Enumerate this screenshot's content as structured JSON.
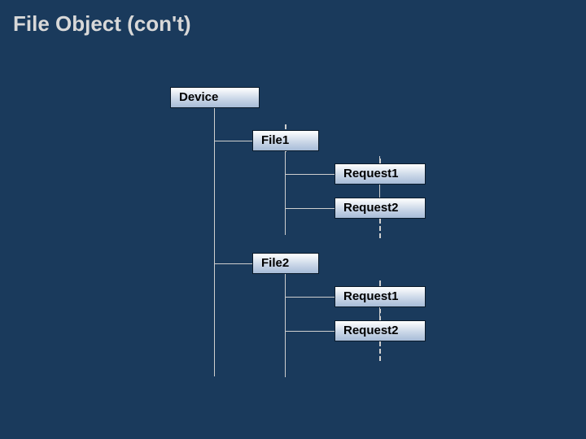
{
  "title": "File Object (con't)",
  "tree": {
    "device": "Device",
    "file1": {
      "label": "File1",
      "req1": "Request1",
      "req2": "Request2"
    },
    "file2": {
      "label": "File2",
      "req1": "Request1",
      "req2": "Request2"
    }
  }
}
